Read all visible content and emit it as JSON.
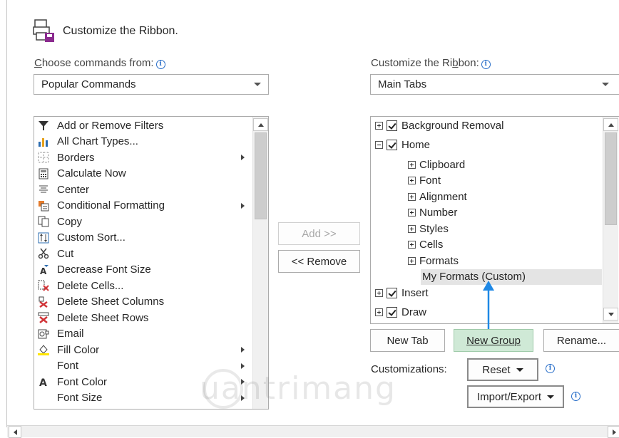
{
  "header": {
    "title": "Customize the Ribbon."
  },
  "left_panel": {
    "label_prefix": "C",
    "label_rest": "hoose commands from:",
    "dropdown_value": "Popular Commands",
    "commands": [
      {
        "label": "Add or Remove Filters",
        "icon": "filter-icon"
      },
      {
        "label": "All Chart Types...",
        "icon": "chart-icon"
      },
      {
        "label": "Borders",
        "icon": "borders-icon",
        "submenu": true
      },
      {
        "label": "Calculate Now",
        "icon": "calculator-icon"
      },
      {
        "label": "Center",
        "icon": "center-align-icon"
      },
      {
        "label": "Conditional Formatting",
        "icon": "conditional-formatting-icon",
        "submenu": true
      },
      {
        "label": "Copy",
        "icon": "copy-icon"
      },
      {
        "label": "Custom Sort...",
        "icon": "sort-icon"
      },
      {
        "label": "Cut",
        "icon": "scissors-icon"
      },
      {
        "label": "Decrease Font Size",
        "icon": "decrease-font-icon"
      },
      {
        "label": "Delete Cells...",
        "icon": "delete-cells-icon"
      },
      {
        "label": "Delete Sheet Columns",
        "icon": "delete-columns-icon"
      },
      {
        "label": "Delete Sheet Rows",
        "icon": "delete-rows-icon"
      },
      {
        "label": "Email",
        "icon": "email-icon"
      },
      {
        "label": "Fill Color",
        "icon": "fill-color-icon",
        "submenu": true
      },
      {
        "label": "Font",
        "icon": "",
        "submenu": true
      },
      {
        "label": "Font Color",
        "icon": "font-color-icon",
        "submenu": true
      },
      {
        "label": "Font Size",
        "icon": "",
        "submenu": true
      }
    ]
  },
  "middle": {
    "add_label": "Add >>",
    "remove_label": "<< Remove"
  },
  "right_panel": {
    "label_prefix": "Customize the Ri",
    "label_underlined": "b",
    "label_rest": "bon:",
    "dropdown_value": "Main Tabs",
    "tree": [
      {
        "label": "Background Removal",
        "level": 0,
        "expander": "plus",
        "checked": true
      },
      {
        "label": "Home",
        "level": 0,
        "expander": "minus",
        "checked": true
      },
      {
        "label": "Clipboard",
        "level": 1,
        "expander": "plus"
      },
      {
        "label": "Font",
        "level": 1,
        "expander": "plus"
      },
      {
        "label": "Alignment",
        "level": 1,
        "expander": "plus"
      },
      {
        "label": "Number",
        "level": 1,
        "expander": "plus"
      },
      {
        "label": "Styles",
        "level": 1,
        "expander": "plus"
      },
      {
        "label": "Cells",
        "level": 1,
        "expander": "plus"
      },
      {
        "label": "Formats",
        "level": 1,
        "expander": "plus"
      },
      {
        "label": "My Formats (Custom)",
        "level": 2,
        "selected": true
      },
      {
        "label": "Insert",
        "level": 0,
        "expander": "plus",
        "checked": true
      },
      {
        "label": "Draw",
        "level": 0,
        "expander": "plus",
        "checked": true
      }
    ],
    "buttons": {
      "new_tab": "New Tab",
      "new_group": "New Group",
      "rename": "Rename..."
    },
    "customizations_label": "Customizations:",
    "reset_label": "Reset",
    "import_export_label": "Import/Export"
  },
  "watermark": "uantrimang",
  "colors": {
    "accent_arrow": "#1e88e5",
    "selection": "#e4e4e4",
    "new_group_bg": "#cfe9d6"
  }
}
